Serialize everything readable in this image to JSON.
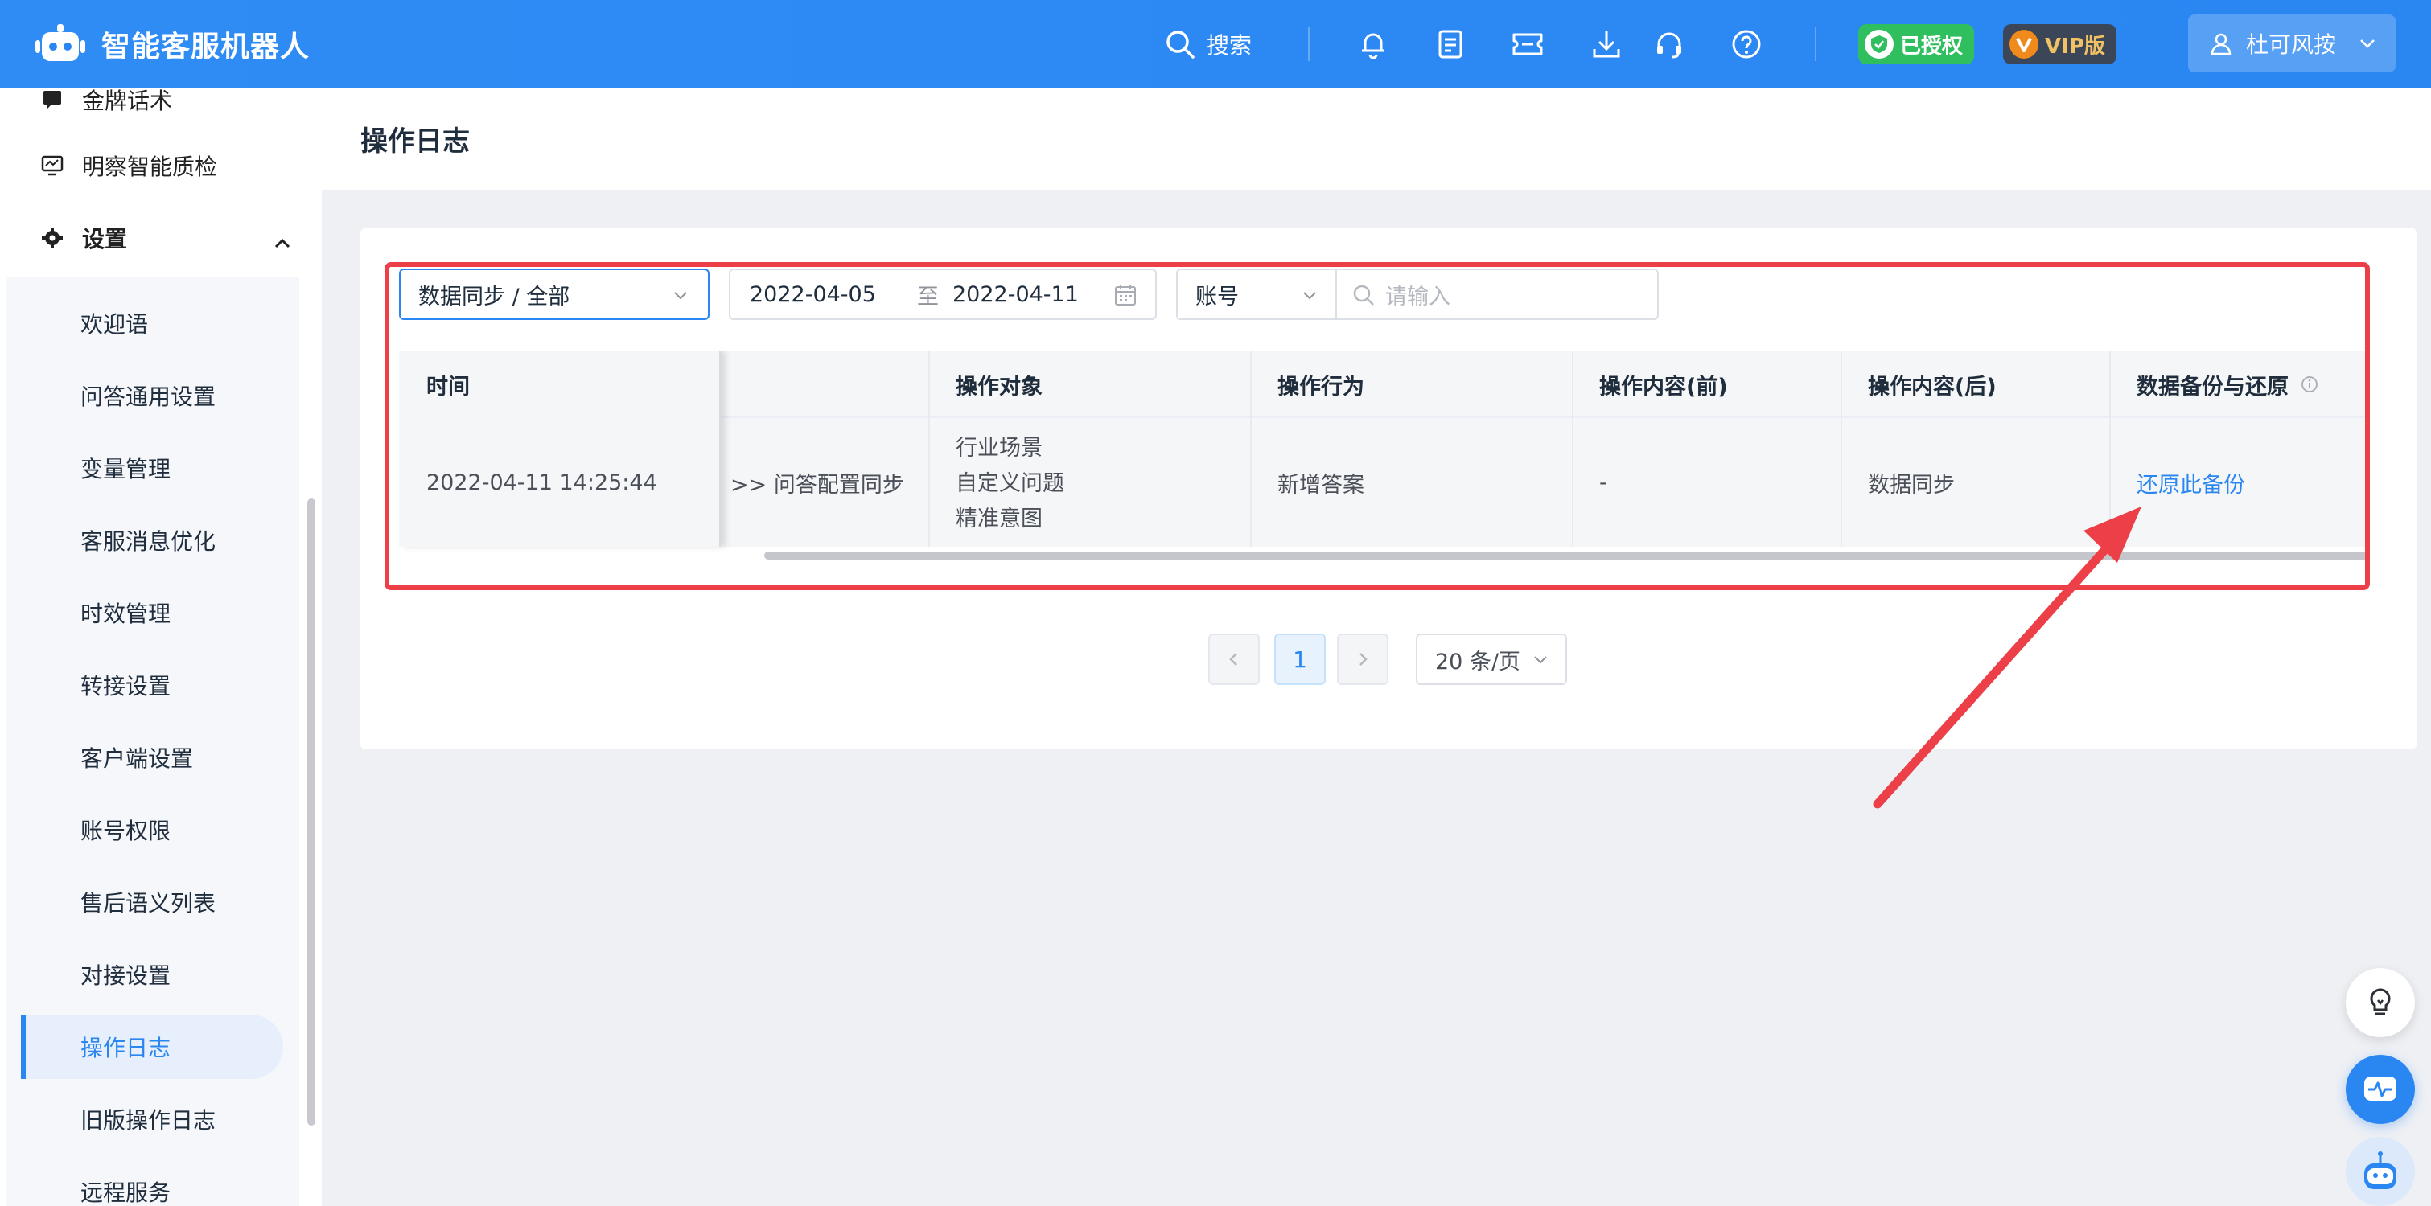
{
  "app": {
    "title": "智能客服机器人"
  },
  "topbar": {
    "search_label": "搜索",
    "icons": [
      "bell-icon",
      "checklist-icon",
      "ticket-icon",
      "download-icon",
      "headset-icon",
      "help-icon"
    ],
    "badge_authorized": "已授权",
    "badge_vip": "VIP版",
    "user_name": "杜可风按"
  },
  "sidebar": {
    "top_items": [
      {
        "label": "金牌话术",
        "icon": "chat-icon"
      },
      {
        "label": "明察智能质检",
        "icon": "monitor-icon"
      },
      {
        "label": "设置",
        "icon": "gear-icon"
      }
    ],
    "sub_items": [
      {
        "label": "欢迎语"
      },
      {
        "label": "问答通用设置"
      },
      {
        "label": "变量管理"
      },
      {
        "label": "客服消息优化"
      },
      {
        "label": "时效管理"
      },
      {
        "label": "转接设置"
      },
      {
        "label": "客户端设置"
      },
      {
        "label": "账号权限"
      },
      {
        "label": "售后语义列表"
      },
      {
        "label": "对接设置"
      },
      {
        "label": "操作日志",
        "active": true
      },
      {
        "label": "旧版操作日志"
      },
      {
        "label": "远程服务"
      }
    ]
  },
  "page": {
    "title": "操作日志"
  },
  "filters": {
    "category_value": "数据同步 / 全部",
    "date_start": "2022-04-05",
    "date_separator": "至",
    "date_end": "2022-04-11",
    "account_select": "账号",
    "search_placeholder": "请输入"
  },
  "table": {
    "headers": [
      "时间",
      "操作对象",
      "操作行为",
      "操作内容(前)",
      "操作内容(后)",
      "数据备份与还原"
    ],
    "row": {
      "time": "2022-04-11 14:25:44",
      "module": ">> 问答配置同步",
      "objects": [
        "行业场景",
        "自定义问题",
        "精准意图"
      ],
      "action": "新增答案",
      "before": "-",
      "after": "数据同步",
      "restore_link": "还原此备份"
    }
  },
  "pagination": {
    "current_page": "1",
    "page_size": "20 条/页"
  },
  "colors": {
    "brand": "#2a86f1",
    "highlight": "#ec3f47",
    "auth_badge": "#2fbf5f",
    "vip_badge": "#3b4658"
  }
}
